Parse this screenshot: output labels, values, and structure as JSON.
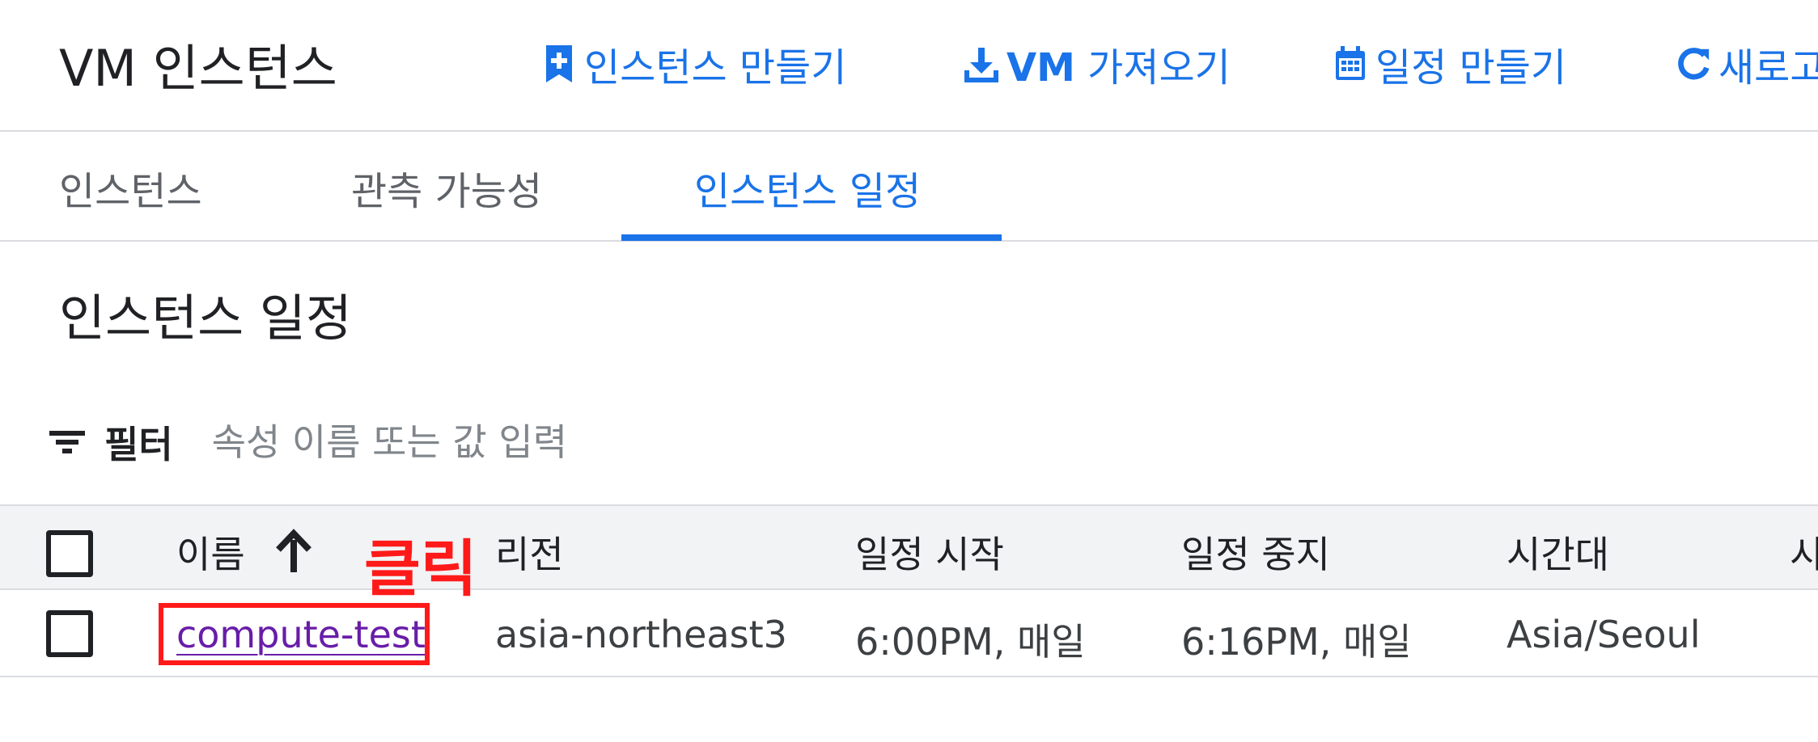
{
  "header": {
    "title": "VM 인스턴스",
    "actions": [
      {
        "label": "인스턴스 만들기",
        "icon": "add-box-icon"
      },
      {
        "label_bold": "VM",
        "label": " 가져오기",
        "icon": "download-icon"
      },
      {
        "label": "일정 만들기",
        "icon": "calendar-icon"
      },
      {
        "label": "새로고",
        "icon": "refresh-icon"
      }
    ]
  },
  "tabs": [
    {
      "label": "인스턴스",
      "active": false
    },
    {
      "label": "관측 가능성",
      "active": false
    },
    {
      "label": "인스턴스 일정",
      "active": true
    }
  ],
  "section": {
    "title": "인스턴스 일정"
  },
  "filter": {
    "label": "필터",
    "placeholder": "속성 이름 또는 값 입력",
    "icon": "filter-icon"
  },
  "table": {
    "columns": [
      "이름",
      "리전",
      "일정 시작",
      "일정 중지",
      "시간대",
      "시"
    ],
    "sort": {
      "column": "이름",
      "direction": "ascending"
    },
    "rows": [
      {
        "name": "compute-test",
        "region": "asia-northeast3",
        "start": "6:00PM, 매일",
        "stop": "6:16PM, 매일",
        "timezone": "Asia/Seoul"
      }
    ]
  },
  "annotation": {
    "label": "클릭",
    "color": "#ff1a1a"
  },
  "colors": {
    "accent": "#1a73e8",
    "link_visited": "#681da8",
    "header_bg": "#f1f3f4",
    "divider": "#dadce0"
  }
}
